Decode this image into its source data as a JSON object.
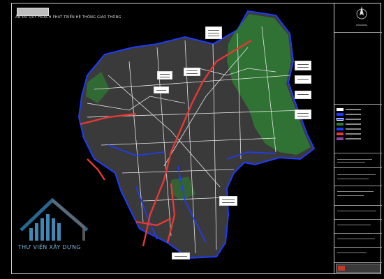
{
  "drawing": {
    "title": "ẢN ĐỒ QUY HOẠCH PHÁT TRIỂN HỆ THỐNG GIAO THÔNG"
  },
  "watermark": {
    "text": "THƯ VIỆN XÂY DỰNG"
  },
  "colors": {
    "background": "#000000",
    "district_fill": "#3a3a3a",
    "green_area": "#2e7d32",
    "roads": "#ffffff",
    "main_roads": "#e53935",
    "water_lines": "#1e3cff",
    "watermark": "#4a9fd4"
  },
  "icons": {
    "north_arrow": "north-arrow-icon",
    "watermark_logo": "building-logo-icon"
  }
}
